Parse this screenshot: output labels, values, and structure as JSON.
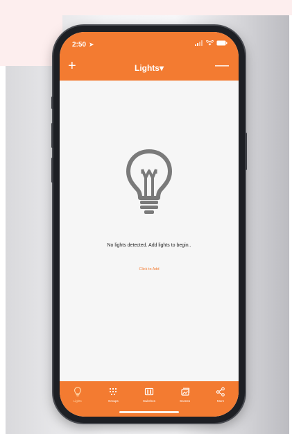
{
  "status": {
    "time": "2:50"
  },
  "nav": {
    "add_label": "+",
    "title": "Lights▾",
    "minus_label": "—"
  },
  "empty": {
    "message": "No lights detected. Add lights to begin..",
    "action": "Click to Add"
  },
  "tabs": [
    {
      "label": "Lights",
      "icon": "bulb-icon",
      "active": true
    },
    {
      "label": "Groups",
      "icon": "grid-icon",
      "active": false
    },
    {
      "label": "Switches",
      "icon": "switch-icon",
      "active": false
    },
    {
      "label": "Scenes",
      "icon": "scenes-icon",
      "active": false
    },
    {
      "label": "More",
      "icon": "share-icon",
      "active": false
    }
  ],
  "colors": {
    "accent": "#f37b31",
    "active_tab": "#ffd6a8",
    "bulb": "#7a7a7a"
  }
}
